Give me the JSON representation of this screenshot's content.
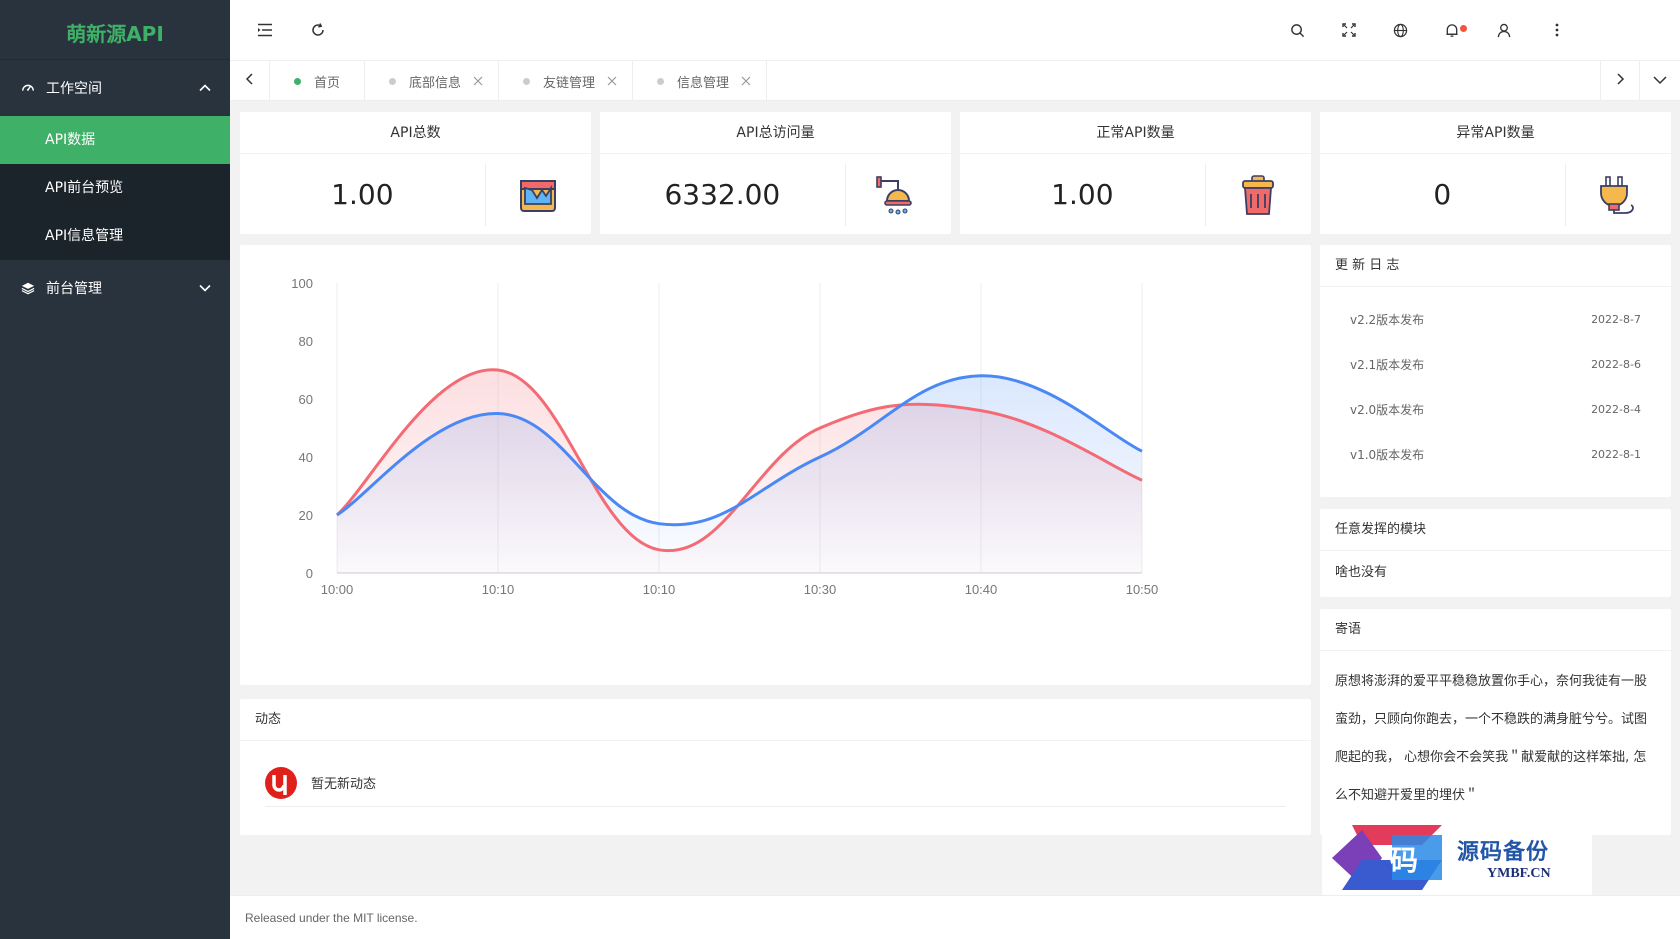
{
  "app": {
    "logo": "萌新源API"
  },
  "sidebar": {
    "groups": [
      {
        "label": "工作空间",
        "icon": "dashboard-icon",
        "expanded": true,
        "items": [
          {
            "label": "API数据",
            "active": true
          },
          {
            "label": "API前台预览"
          },
          {
            "label": "API信息管理"
          }
        ]
      },
      {
        "label": "前台管理",
        "icon": "layers-icon",
        "expanded": false
      }
    ]
  },
  "tabs": [
    {
      "label": "首页",
      "active": true
    },
    {
      "label": "底部信息"
    },
    {
      "label": "友链管理"
    },
    {
      "label": "信息管理"
    }
  ],
  "stats": [
    {
      "title": "API总数",
      "value": "1.00",
      "icon": "paint-bucket-icon"
    },
    {
      "title": "API总访问量",
      "value": "6332.00",
      "icon": "shower-icon"
    },
    {
      "title": "正常API数量",
      "value": "1.00",
      "icon": "trash-can-icon"
    },
    {
      "title": "异常API数量",
      "value": "0",
      "icon": "power-plug-icon"
    }
  ],
  "chart_data": {
    "type": "line",
    "categories": [
      "10:00",
      "10:10",
      "10:10",
      "10:30",
      "10:40",
      "10:50"
    ],
    "ylim": [
      0,
      100
    ],
    "yticks": [
      0,
      20,
      40,
      60,
      80,
      100
    ],
    "series": [
      {
        "values": [
          20,
          70,
          8,
          50,
          56,
          32
        ],
        "color": "#f36b74"
      },
      {
        "values": [
          20,
          55,
          17,
          40,
          68,
          42
        ],
        "color": "#4a89f5"
      }
    ],
    "grid": true,
    "title": "",
    "xlabel": "",
    "ylabel": ""
  },
  "changelog": {
    "title": "更 新 日 志",
    "items": [
      {
        "label": "v2.2版本发布",
        "date": "2022-8-7"
      },
      {
        "label": "v2.1版本发布",
        "date": "2022-8-6"
      },
      {
        "label": "v2.0版本发布",
        "date": "2022-8-4"
      },
      {
        "label": "v1.0版本发布",
        "date": "2022-8-1"
      }
    ]
  },
  "module": {
    "title": "任意发挥的模块",
    "text": "啥也没有"
  },
  "message": {
    "title": "寄语",
    "text": "原想将澎湃的爱平平稳稳放置你手心，奈何我徒有一股蛮劲，只顾向你跑去，一个不稳跌的满身脏兮兮。试图爬起的我， 心想你会不会笑我＂献爱献的这样笨拙, 怎么不知避开爱里的埋伏＂"
  },
  "activity": {
    "title": "动态",
    "empty": "暂无新动态"
  },
  "footer": {
    "text": "Released under the MIT license."
  },
  "watermark": {
    "cn": "源码备份",
    "en": "YMBF.CN",
    "badge": "码"
  }
}
